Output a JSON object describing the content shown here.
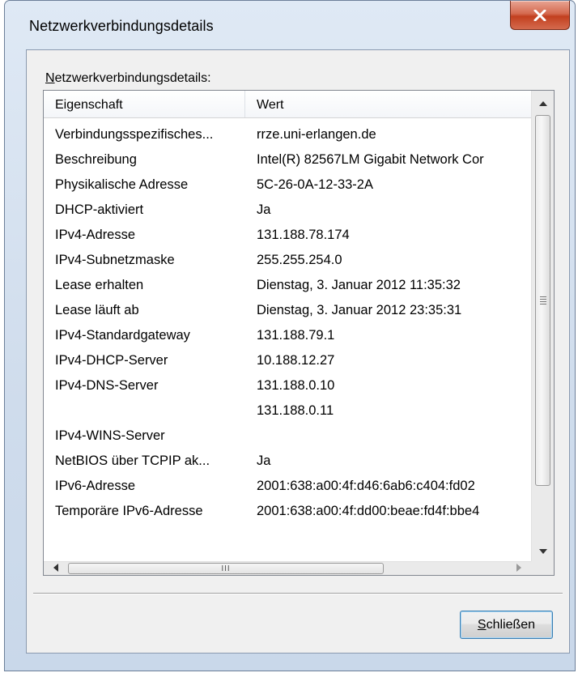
{
  "window": {
    "title": "Netzwerkverbindungsdetails",
    "close_glyph": "X"
  },
  "caption": {
    "mnemonic": "N",
    "rest": "etzwerkverbindungsdetails:"
  },
  "table": {
    "columns": [
      "Eigenschaft",
      "Wert"
    ],
    "rows": [
      {
        "key": "Verbindungsspezifisches...",
        "value": "rrze.uni-erlangen.de"
      },
      {
        "key": "Beschreibung",
        "value": "Intel(R) 82567LM Gigabit Network Cor"
      },
      {
        "key": "Physikalische Adresse",
        "value": "5C-26-0A-12-33-2A"
      },
      {
        "key": "DHCP-aktiviert",
        "value": "Ja"
      },
      {
        "key": "IPv4-Adresse",
        "value": "131.188.78.174"
      },
      {
        "key": "IPv4-Subnetzmaske",
        "value": "255.255.254.0"
      },
      {
        "key": "Lease erhalten",
        "value": "Dienstag, 3. Januar 2012 11:35:32"
      },
      {
        "key": "Lease läuft ab",
        "value": "Dienstag, 3. Januar 2012 23:35:31"
      },
      {
        "key": "IPv4-Standardgateway",
        "value": "131.188.79.1"
      },
      {
        "key": "IPv4-DHCP-Server",
        "value": "10.188.12.27"
      },
      {
        "key": "IPv4-DNS-Server",
        "value": "131.188.0.10"
      },
      {
        "key": "",
        "value": "131.188.0.11"
      },
      {
        "key": "IPv4-WINS-Server",
        "value": ""
      },
      {
        "key": "NetBIOS über TCPIP ak...",
        "value": "Ja"
      },
      {
        "key": "IPv6-Adresse",
        "value": "2001:638:a00:4f:d46:6ab6:c404:fd02"
      },
      {
        "key": "Temporäre IPv6-Adresse",
        "value": "2001:638:a00:4f:dd00:beae:fd4f:bbe4"
      }
    ]
  },
  "scrollbar": {
    "h_thumb_grip": "III"
  },
  "buttons": {
    "close_mnemonic": "S",
    "close_rest": "chließen"
  },
  "colors": {
    "close_button": "#c2401f",
    "button_border": "#3c7fb1",
    "frame": "#cfdcec"
  }
}
